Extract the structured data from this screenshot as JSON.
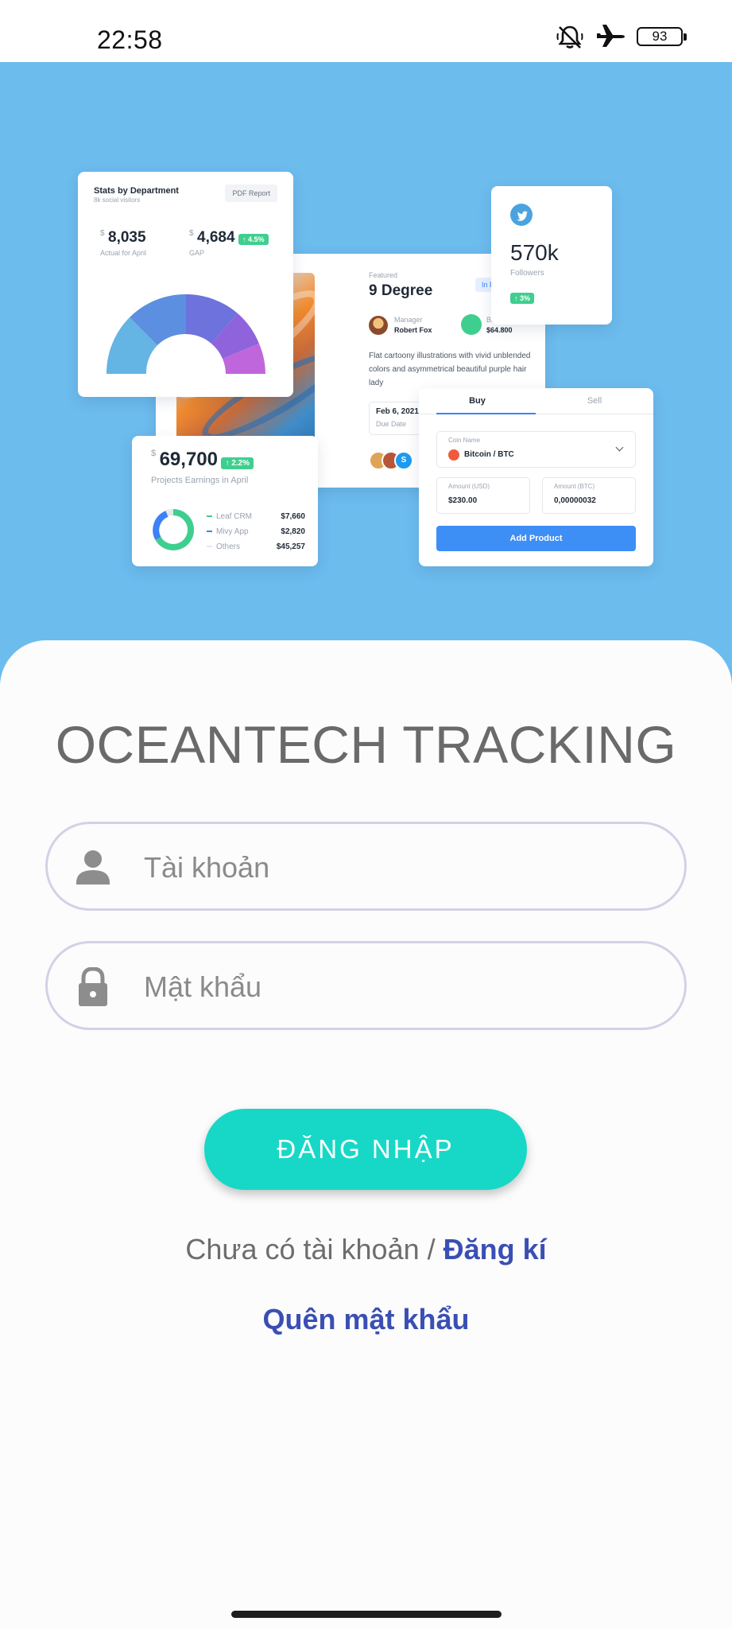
{
  "status_bar": {
    "time": "22:58",
    "battery": "93",
    "icons": [
      "bell-off-icon",
      "airplane-icon",
      "battery-icon"
    ]
  },
  "hero": {
    "dept_card": {
      "title": "Stats by Department",
      "subtitle": "8k social visitors",
      "button": "PDF Report",
      "stat1_value": "8,035",
      "stat1_label": "Actual for April",
      "stat2_value": "4,684",
      "stat2_badge": "↑ 4.5%",
      "stat2_label": "GAP",
      "currency": "$"
    },
    "feature_card": {
      "kicker": "Featured",
      "title": "9 Degree",
      "tag": "In P",
      "manager_label": "Manager",
      "manager_name": "Robert Fox",
      "budget_label": "Budget",
      "budget_value": "$64.800",
      "description": "Flat cartoony illustrations with vivid unblended colors and asymmetrical beautiful purple hair lady",
      "due_value": "Feb 6, 2021",
      "due_label": "Due Date",
      "avatar_letter": "S"
    },
    "twitter_card": {
      "value": "570k",
      "label": "Followers",
      "badge": "↑ 3%"
    },
    "earnings_card": {
      "currency": "$",
      "value": "69,700",
      "badge": "↑ 2.2%",
      "label": "Projects Earnings in April",
      "rows": [
        {
          "name": "Leaf CRM",
          "value": "$7,660"
        },
        {
          "name": "Mivy App",
          "value": "$2,820"
        },
        {
          "name": "Others",
          "value": "$45,257"
        }
      ]
    },
    "trade_card": {
      "tab_buy": "Buy",
      "tab_sell": "Sell",
      "coin_label": "Coin Name",
      "coin_value": "Bitcoin / BTC",
      "usd_label": "Amount (USD)",
      "usd_value": "$230.00",
      "btc_label": "Amount (BTC)",
      "btc_value": "0,00000032",
      "button": "Add Product"
    }
  },
  "login": {
    "title": "OCEANTECH TRACKING",
    "username_placeholder": "Tài khoản",
    "password_placeholder": "Mật khẩu",
    "login_button": "ĐĂNG NHẬP",
    "no_account_text": "Chưa có tài khoản / ",
    "register_link": "Đăng kí",
    "forgot_link": "Quên mật khẩu"
  },
  "colors": {
    "hero_bg": "#6dbcee",
    "accent_button": "#17d8c6",
    "link": "#3a4fb3",
    "field_border": "#d3d1e6"
  }
}
